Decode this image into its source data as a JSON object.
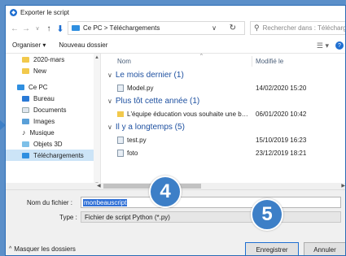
{
  "window": {
    "title": "Exporter le script"
  },
  "address": {
    "path": "Ce PC  >  Téléchargements",
    "search_placeholder": "Rechercher dans : Téléchargements"
  },
  "toolbar": {
    "organize": "Organiser ▾",
    "new_folder": "Nouveau dossier"
  },
  "sidebar": {
    "items": [
      {
        "label": "2020-mars",
        "icon": "folder-icon"
      },
      {
        "label": "New",
        "icon": "folder-icon"
      },
      {
        "label": "Ce PC",
        "icon": "pc-icon"
      },
      {
        "label": "Bureau",
        "icon": "desktop-icon"
      },
      {
        "label": "Documents",
        "icon": "documents-icon"
      },
      {
        "label": "Images",
        "icon": "images-icon"
      },
      {
        "label": "Musique",
        "icon": "music-icon"
      },
      {
        "label": "Objets 3D",
        "icon": "objects3d-icon"
      },
      {
        "label": "Téléchargements",
        "icon": "downloads-icon"
      }
    ]
  },
  "columns": {
    "name": "Nom",
    "modified": "Modifié le"
  },
  "groups": [
    {
      "label": "Le mois dernier (1)"
    },
    {
      "label": "Plus tôt cette année (1)"
    },
    {
      "label": "Il y a longtemps (5)"
    }
  ],
  "files": [
    {
      "name": "Model.py",
      "date": "14/02/2020 15:20"
    },
    {
      "name": "L'équipe éducation vous souhaite une belle année...",
      "date": "06/01/2020 10:42"
    },
    {
      "name": "test.py",
      "date": "15/10/2019 16:23"
    },
    {
      "name": "foto",
      "date": "23/12/2019 18:21"
    }
  ],
  "form": {
    "filename_label": "Nom du fichier :",
    "filename_value": "monbeauscript",
    "type_label": "Type :",
    "type_value": "Fichier de script Python (*.py)"
  },
  "footer": {
    "hide_folders": "Masquer les dossiers",
    "save": "Enregistrer",
    "cancel": "Annuler"
  },
  "annotations": {
    "step4": "4",
    "step5": "5"
  },
  "colors": {
    "accent": "#1f6fd1",
    "badge": "#3d7fc7",
    "group_text": "#1e50a0"
  }
}
